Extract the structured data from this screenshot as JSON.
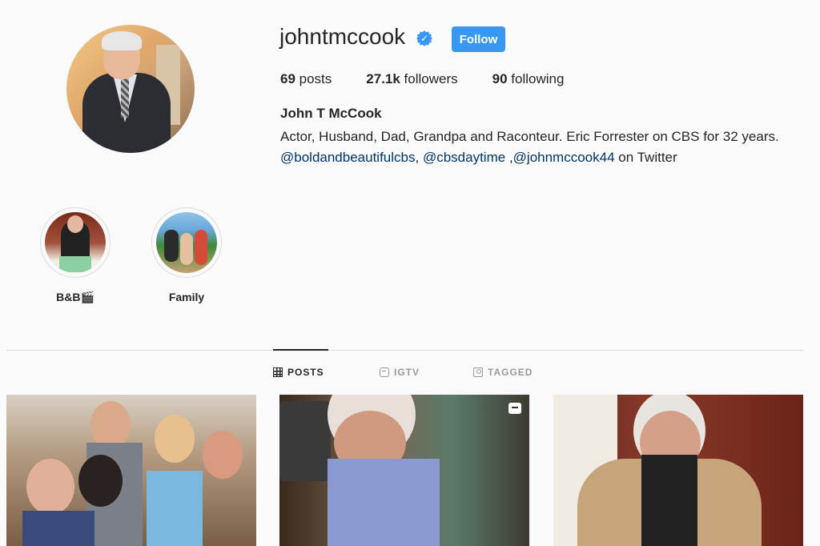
{
  "profile": {
    "username": "johntmccook",
    "verified": true,
    "follow_label": "Follow",
    "stats": {
      "posts_count": "69",
      "posts_label": " posts",
      "followers_count": "27.1k",
      "followers_label": " followers",
      "following_count": "90",
      "following_label": " following"
    },
    "full_name": "John T McCook",
    "bio_line1": "Actor, Husband, Dad, Grandpa and Raconteur. Eric Forrester on CBS for 32 years.",
    "bio_link1": "@boldandbeautifulcbs",
    "bio_sep1": ", ",
    "bio_link2": "@cbsdaytime",
    "bio_sep2": " ,",
    "bio_link3": "@johnmccook44",
    "bio_suffix": " on Twitter"
  },
  "highlights": [
    {
      "label": "B&B🎬"
    },
    {
      "label": "Family"
    }
  ],
  "tabs": [
    {
      "label": "POSTS",
      "icon": "grid-icon",
      "active": true
    },
    {
      "label": "IGTV",
      "icon": "igtv-icon",
      "active": false
    },
    {
      "label": "TAGGED",
      "icon": "tagged-icon",
      "active": false
    }
  ],
  "colors": {
    "accent": "#3897f0",
    "link": "#003569",
    "text": "#262626",
    "muted": "#999999",
    "background": "#fafafa"
  }
}
